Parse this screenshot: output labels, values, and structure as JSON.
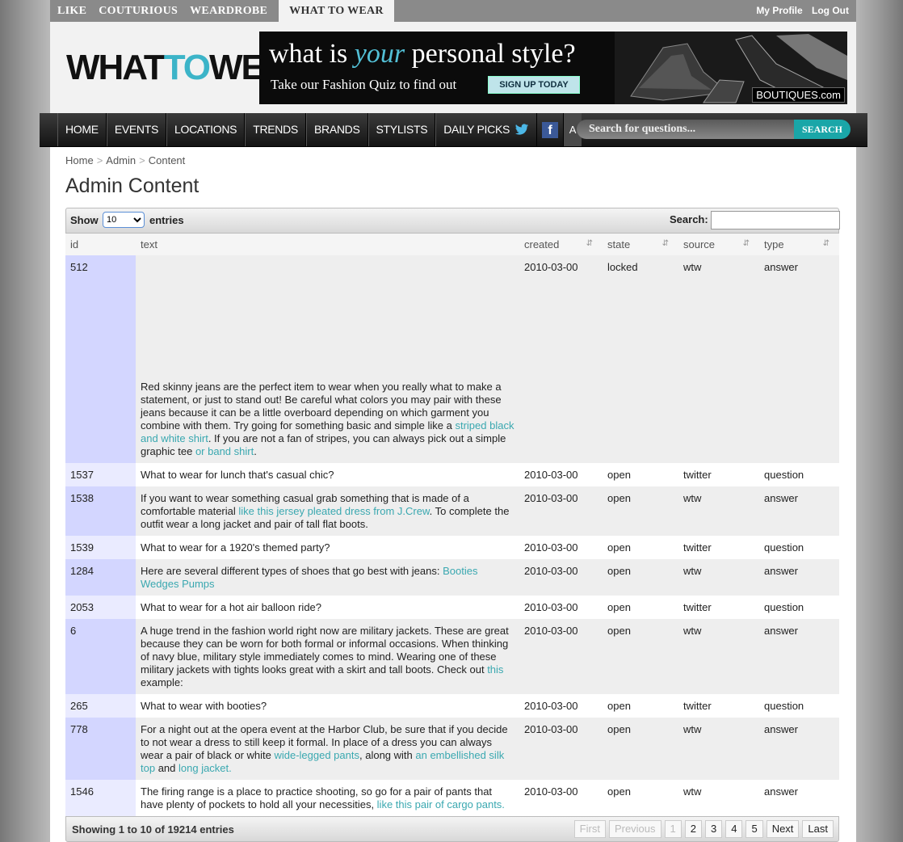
{
  "topnav": {
    "items": [
      "LIKE",
      "COUTURIOUS",
      "WEARDROBE",
      "WHAT TO WEAR"
    ],
    "links": [
      "My Profile",
      "Log Out"
    ]
  },
  "header": {
    "logo_part1": "WHAT",
    "logo_part2": "TO",
    "logo_part3": "WEAR",
    "banner": {
      "headline_pre": "what is ",
      "headline_em": "your",
      "headline_post": " personal style?",
      "sub": "Take our Fashion Quiz to find out",
      "signup": "SIGN UP TODAY",
      "brand": "BOUTIQUES.com"
    }
  },
  "mainnav": {
    "items": [
      "HOME",
      "EVENTS",
      "LOCATIONS",
      "TRENDS",
      "BRANDS",
      "STYLISTS",
      "DAILY PICKS"
    ],
    "a_label": "A",
    "search_placeholder": "Search for questions...",
    "search_button": "SEARCH"
  },
  "breadcrumb": [
    "Home",
    "Admin",
    "Content"
  ],
  "title": "Admin Content",
  "table": {
    "show_label": "Show",
    "show_value": "10",
    "entries_label": "entries",
    "search_label": "Search:",
    "columns": [
      "id",
      "text",
      "created",
      "state",
      "source",
      "type"
    ],
    "rows": [
      {
        "id": "512",
        "text": [
          {
            "t": "Red skinny jeans are the perfect item to wear when you really what to make a statement, or just to stand out! Be careful what colors you may pair with these jeans because it can be a little overboard depending on which garment you combine with them. Try going for something basic and simple like a "
          },
          {
            "t": "striped black and white shirt",
            "link": true
          },
          {
            "t": ". If you are not a fan of stripes, you can always pick out a simple graphic tee "
          },
          {
            "t": "or band shirt",
            "link": true
          },
          {
            "t": "."
          }
        ],
        "created": "2010-03-00",
        "state": "locked",
        "source": "wtw",
        "type": "answer"
      },
      {
        "id": "1537",
        "text": [
          {
            "t": "What to wear for lunch that's casual chic?"
          }
        ],
        "created": "2010-03-00",
        "state": "open",
        "source": "twitter",
        "type": "question"
      },
      {
        "id": "1538",
        "text": [
          {
            "t": "If you want to wear something casual grab something that is made of a comfortable material "
          },
          {
            "t": "like this jersey pleated dress from J.Crew",
            "link": true
          },
          {
            "t": ". To complete the outfit wear a long jacket and pair of tall flat boots."
          }
        ],
        "created": "2010-03-00",
        "state": "open",
        "source": "wtw",
        "type": "answer"
      },
      {
        "id": "1539",
        "text": [
          {
            "t": "What to wear for a 1920's themed party?"
          }
        ],
        "created": "2010-03-00",
        "state": "open",
        "source": "twitter",
        "type": "question"
      },
      {
        "id": "1284",
        "text": [
          {
            "t": "Here are several different types of shoes that go best with jeans: "
          },
          {
            "t": "Booties Wedges Pumps",
            "link": true
          }
        ],
        "created": "2010-03-00",
        "state": "open",
        "source": "wtw",
        "type": "answer"
      },
      {
        "id": "2053",
        "text": [
          {
            "t": "What to wear for a hot air balloon ride?"
          }
        ],
        "created": "2010-03-00",
        "state": "open",
        "source": "twitter",
        "type": "question"
      },
      {
        "id": "6",
        "text": [
          {
            "t": "A huge trend in the fashion world right now are military jackets. These are great because they can be worn for both formal or informal occasions. When thinking of navy blue, military style immediately comes to mind. Wearing one of these military jackets with tights looks great with a skirt and tall boots. Check out "
          },
          {
            "t": "this",
            "link": true
          },
          {
            "t": " example:"
          }
        ],
        "created": "2010-03-00",
        "state": "open",
        "source": "wtw",
        "type": "answer"
      },
      {
        "id": "265",
        "text": [
          {
            "t": "What to wear with booties?"
          }
        ],
        "created": "2010-03-00",
        "state": "open",
        "source": "twitter",
        "type": "question"
      },
      {
        "id": "778",
        "text": [
          {
            "t": "For a night out at the opera event at the Harbor Club, be sure that if you decide to not wear a dress to still keep it formal. In place of a dress you can always wear a pair of black or white "
          },
          {
            "t": "wide-legged pants",
            "link": true
          },
          {
            "t": ", along with "
          },
          {
            "t": "an embellished silk top",
            "link": true
          },
          {
            "t": " and "
          },
          {
            "t": "long jacket.",
            "link": true
          }
        ],
        "created": "2010-03-00",
        "state": "open",
        "source": "wtw",
        "type": "answer"
      },
      {
        "id": "1546",
        "text": [
          {
            "t": "The firing range is a place to practice shooting, so go for a pair of pants that have plenty of pockets to hold all your necessities, "
          },
          {
            "t": "like this pair of cargo pants.",
            "link": true
          }
        ],
        "created": "2010-03-00",
        "state": "open",
        "source": "wtw",
        "type": "answer"
      }
    ],
    "info": "Showing 1 to 10 of 19214 entries",
    "pager": {
      "first": "First",
      "previous": "Previous",
      "pages": [
        "1",
        "2",
        "3",
        "4",
        "5"
      ],
      "current": "1",
      "next": "Next",
      "last": "Last"
    }
  }
}
